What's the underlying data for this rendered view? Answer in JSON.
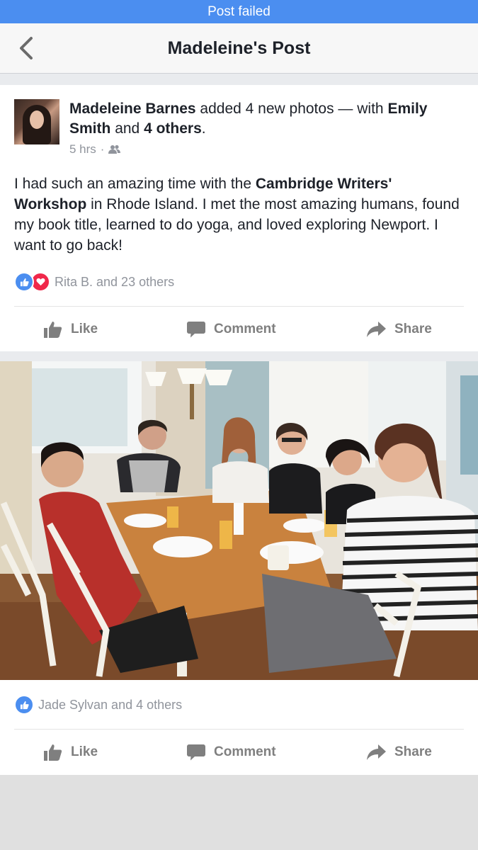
{
  "status_bar": {
    "text": "Post failed"
  },
  "nav": {
    "title": "Madeleine's Post"
  },
  "post": {
    "author": "Madeleine Barnes",
    "action_text": "added 4 new photos — with",
    "tagged_person": "Emily Smith",
    "and_text": "and",
    "others_link": "4 others",
    "period": ".",
    "time": "5 hrs",
    "dot": "·",
    "privacy_icon": "friends-icon",
    "body_part1": "I had such an amazing time with the ",
    "body_bold": "Cambridge Writers' Workshop",
    "body_part2": " in Rhode Island. I met the most amazing humans, found my book title, learned to do yoga, and loved exploring Newport. I want to go back!",
    "reactions_text": "Rita B. and 23 others"
  },
  "actions": {
    "like": "Like",
    "comment": "Comment",
    "share": "Share"
  },
  "photo_post": {
    "reactions_text": "Jade Sylvan and 4 others"
  },
  "colors": {
    "accent": "#4b8ef0",
    "love": "#f0284a",
    "muted": "#90949c",
    "action": "#7f7f7f"
  }
}
